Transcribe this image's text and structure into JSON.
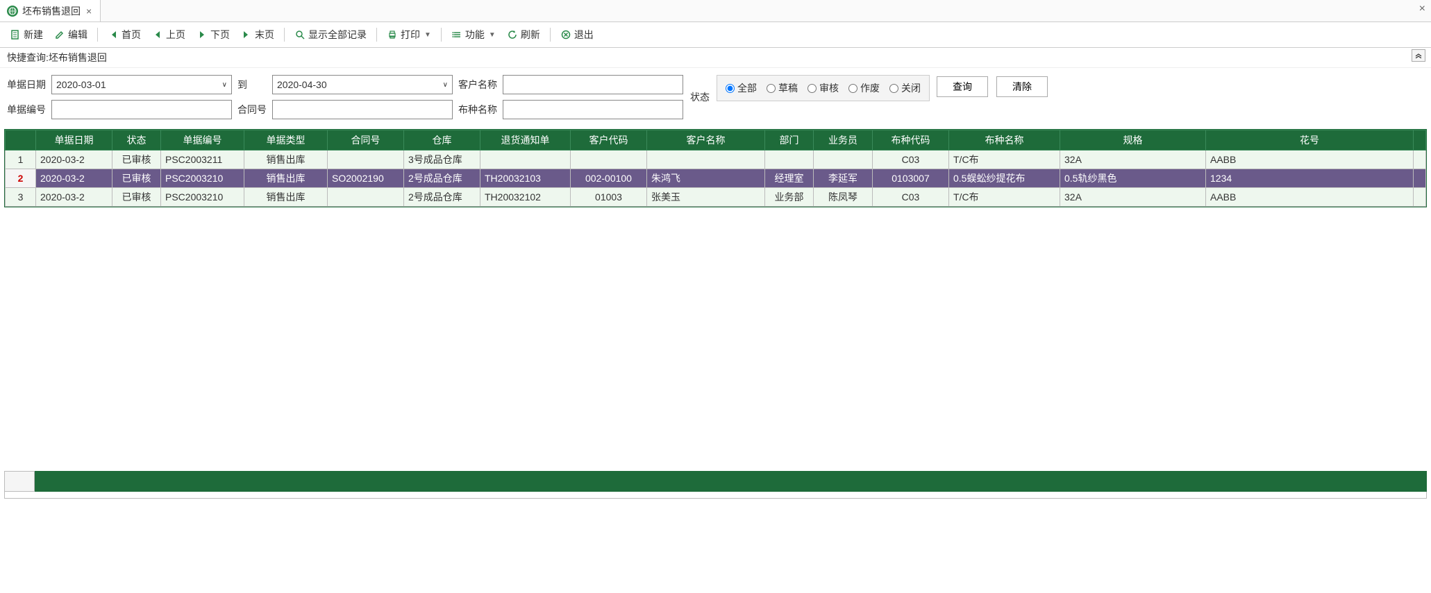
{
  "tab": {
    "title": "坯布销售退回"
  },
  "toolbar": {
    "new": "新建",
    "edit": "编辑",
    "first": "首页",
    "prev": "上页",
    "next": "下页",
    "last": "末页",
    "show_all": "显示全部记录",
    "print": "打印",
    "function": "功能",
    "refresh": "刷新",
    "exit": "退出"
  },
  "quick_query_label": "快捷查询:坯布销售退回",
  "filters": {
    "doc_date_label": "单据日期",
    "date_from": "2020-03-01",
    "to_label": "到",
    "date_to": "2020-04-30",
    "cust_name_label": "客户名称",
    "cust_name": "",
    "doc_no_label": "单据编号",
    "doc_no": "",
    "contract_label": "合同号",
    "contract": "",
    "fabric_label": "布种名称",
    "fabric": "",
    "status_label": "状态",
    "status_options": {
      "all": "全部",
      "draft": "草稿",
      "audited": "审核",
      "void": "作废",
      "closed": "关闭"
    },
    "query_btn": "查询",
    "clear_btn": "清除"
  },
  "columns": [
    "单据日期",
    "状态",
    "单据编号",
    "单据类型",
    "合同号",
    "仓库",
    "退货通知单",
    "客户代码",
    "客户名称",
    "部门",
    "业务员",
    "布种代码",
    "布种名称",
    "规格",
    "花号"
  ],
  "col_align": [
    "left",
    "center",
    "left",
    "center",
    "left",
    "left",
    "left",
    "center",
    "left",
    "center",
    "center",
    "center",
    "left",
    "left",
    "left"
  ],
  "rows": [
    {
      "n": "1",
      "sel": false,
      "cells": [
        "2020-03-2",
        "已审核",
        "PSC2003211",
        "销售出库",
        "",
        "3号成品仓库",
        "",
        "",
        "",
        "",
        "",
        "C03",
        "T/C布",
        "32A",
        "AABB"
      ]
    },
    {
      "n": "2",
      "sel": true,
      "cells": [
        "2020-03-2",
        "已审核",
        "PSC2003210",
        "销售出库",
        "SO2002190",
        "2号成品仓库",
        "TH20032103",
        "002-00100",
        "朱鸿飞",
        "经理室",
        "李延军",
        "0103007",
        "0.5蜈蚣纱提花布",
        "0.5轨纱黑色",
        "1234"
      ]
    },
    {
      "n": "3",
      "sel": false,
      "cells": [
        "2020-03-2",
        "已审核",
        "PSC2003210",
        "销售出库",
        "",
        "2号成品仓库",
        "TH20032102",
        "01003",
        "张美玉",
        "业务部",
        "陈凤琴",
        "C03",
        "T/C布",
        "32A",
        "AABB"
      ]
    }
  ]
}
